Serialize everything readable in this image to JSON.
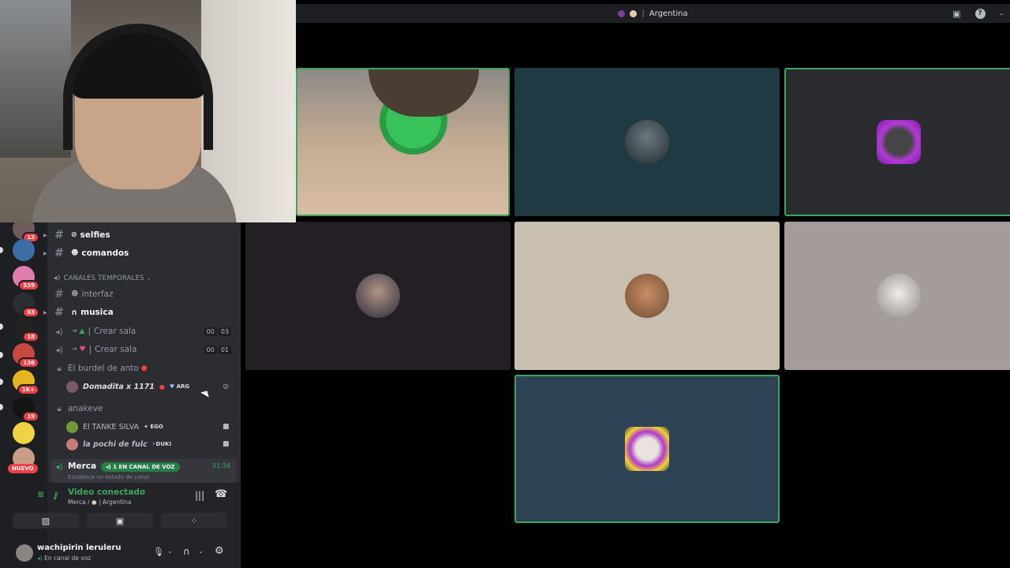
{
  "titlebar": {
    "title": "Argentina"
  },
  "sidebar": {
    "server_badges": [
      "13",
      "539",
      "63",
      "18",
      "136",
      "1K+",
      "19"
    ],
    "nuevo_label": "NUEVO"
  },
  "channels": {
    "selfies": "selfies",
    "comandos": "comandos",
    "category": "CANALES TEMPORALES",
    "interfaz": "interfaz",
    "musica": "musica",
    "crear_sala_1": {
      "label": "Crear sala",
      "count_a": "00",
      "count_b": "03"
    },
    "crear_sala_2": {
      "label": "Crear sala",
      "count_a": "00",
      "count_b": "01"
    },
    "burdel": "El burdel de anto",
    "burdel_member": {
      "name": "Domadita x 1171",
      "tag": "ARG"
    },
    "anakeve": "anakeve",
    "anakeve_members": [
      {
        "name": "El TANKE SILVA",
        "tag": "EGO"
      },
      {
        "name": "la pochi de fulc",
        "tag": "DUKI"
      }
    ],
    "merca": {
      "label": "Merca",
      "badge": "1 EN CANAL DE VOZ",
      "time": "51:34",
      "status": "Establece un estado de canal"
    }
  },
  "voice": {
    "status": "Video conectado",
    "location_left": "Merca /",
    "location_right": "Argentina"
  },
  "user": {
    "name": "wachipirin leruleru",
    "status": "En canal de voz"
  },
  "colors": {
    "accent_green": "#3ba55d",
    "badge_red": "#f23f43",
    "sidebar_bg": "#2b2d31",
    "server_bg": "#1e1f22"
  }
}
